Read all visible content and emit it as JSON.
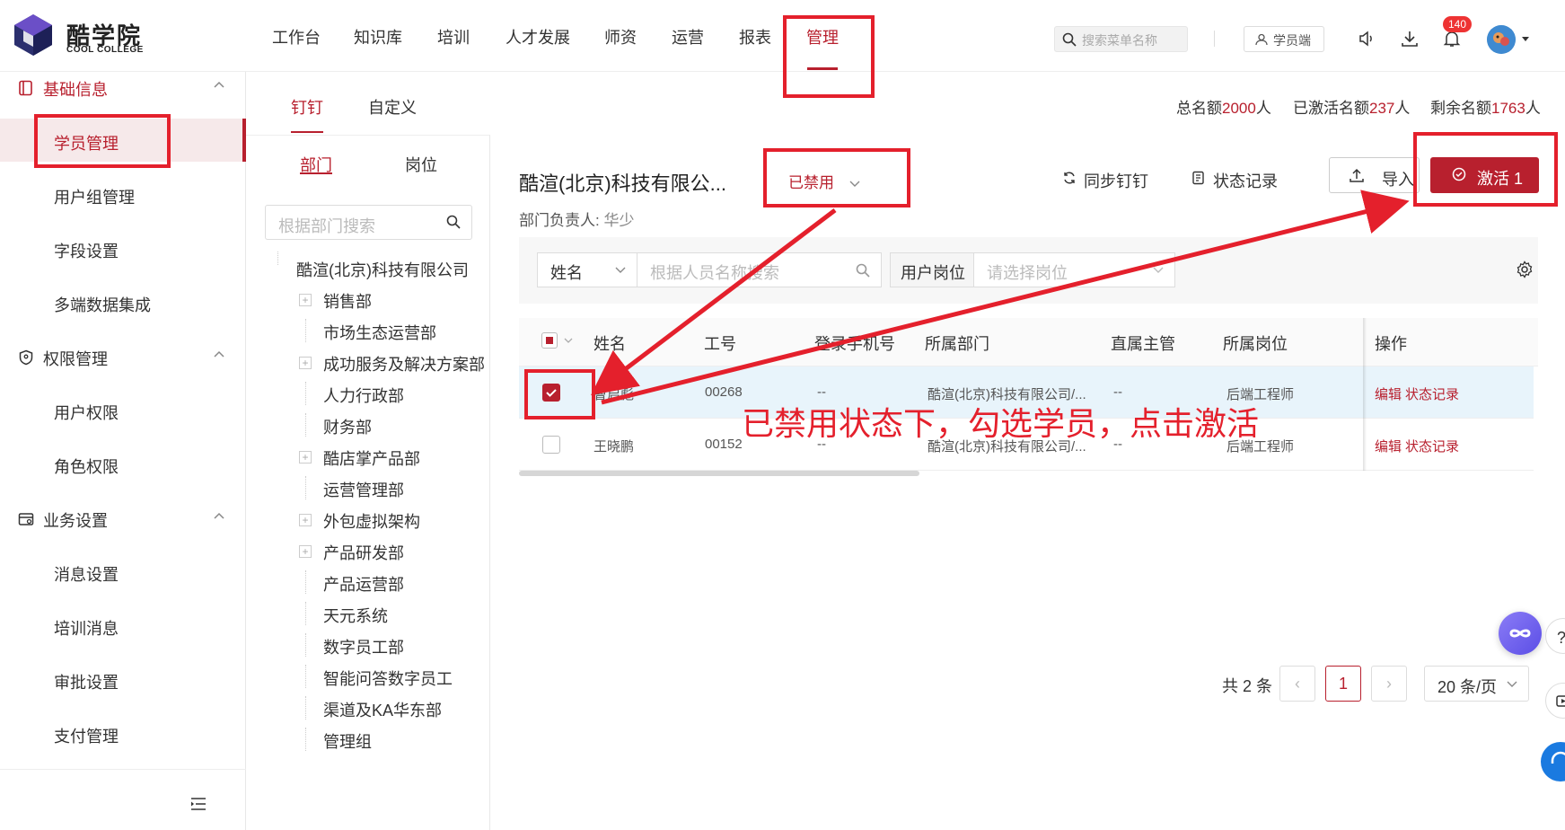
{
  "brand": {
    "name_cn": "酷学院",
    "name_en": "COOL COLLEGE"
  },
  "topnav": {
    "items": [
      "工作台",
      "知识库",
      "培训",
      "人才发展",
      "师资",
      "运营",
      "报表",
      "管理"
    ],
    "active": "管理",
    "search_placeholder": "搜索菜单名称",
    "student_portal": "学员端",
    "notification_count": "140"
  },
  "sidebar": {
    "groups": [
      {
        "label": "基础信息",
        "icon": "book-icon",
        "items": [
          "学员管理",
          "用户组管理",
          "字段设置",
          "多端数据集成"
        ]
      },
      {
        "label": "权限管理",
        "icon": "shield-icon",
        "items": [
          "用户权限",
          "角色权限"
        ]
      },
      {
        "label": "业务设置",
        "icon": "settings-card-icon",
        "items": [
          "消息设置",
          "培训消息",
          "审批设置",
          "支付管理"
        ]
      }
    ],
    "active_item": "学员管理"
  },
  "source_tabs": {
    "items": [
      "钉钉",
      "自定义"
    ],
    "active": "钉钉"
  },
  "quota": {
    "total_label": "总名额",
    "total": "2000",
    "total_unit": "人",
    "activated_label": "已激活名额",
    "activated": "237",
    "activated_unit": "人",
    "remaining_label": "剩余名额",
    "remaining": "1763",
    "remaining_unit": "人"
  },
  "dept_panel": {
    "tabs": [
      "部门",
      "岗位"
    ],
    "active": "部门",
    "search_placeholder": "根据部门搜索",
    "root": "酷渲(北京)科技有限公司",
    "departments": [
      {
        "name": "销售部",
        "expandable": true
      },
      {
        "name": "市场生态运营部",
        "expandable": false
      },
      {
        "name": "成功服务及解决方案部",
        "expandable": true
      },
      {
        "name": "人力行政部",
        "expandable": false
      },
      {
        "name": "财务部",
        "expandable": false
      },
      {
        "name": "酷店掌产品部",
        "expandable": true
      },
      {
        "name": "运营管理部",
        "expandable": false
      },
      {
        "name": "外包虚拟架构",
        "expandable": true
      },
      {
        "name": "产品研发部",
        "expandable": true
      },
      {
        "name": "产品运营部",
        "expandable": false
      },
      {
        "name": "天元系统",
        "expandable": false
      },
      {
        "name": "数字员工部",
        "expandable": false
      },
      {
        "name": "智能问答数字员工",
        "expandable": false
      },
      {
        "name": "渠道及KA华东部",
        "expandable": false
      },
      {
        "name": "管理组",
        "expandable": false
      }
    ]
  },
  "main": {
    "company_title": "酷渲(北京)科技有限公...",
    "status_filter": "已禁用",
    "sync_label": "同步钉钉",
    "status_log_label": "状态记录",
    "import_label": "导入",
    "activate_label": "激活 1",
    "dept_lead_label": "部门负责人:",
    "dept_lead_name": "华少",
    "filter": {
      "field_select": "姓名",
      "name_placeholder": "根据人员名称搜索",
      "position_label": "用户岗位",
      "position_placeholder": "请选择岗位"
    },
    "table": {
      "columns": [
        "姓名",
        "工号",
        "登录手机号",
        "所属部门",
        "直属主管",
        "所属岗位",
        "操作"
      ],
      "rows": [
        {
          "checked": true,
          "name": "曹启彪",
          "id": "00268",
          "phone": "--",
          "dept": "酷渲(北京)科技有限公司/...",
          "manager": "--",
          "position": "后端工程师",
          "edit": "编辑",
          "log": "状态记录"
        },
        {
          "checked": false,
          "name": "王晓鹏",
          "id": "00152",
          "phone": "--",
          "dept": "酷渲(北京)科技有限公司/...",
          "manager": "--",
          "position": "后端工程师",
          "edit": "编辑",
          "log": "状态记录"
        }
      ]
    },
    "pagination": {
      "total": "共 2 条",
      "current": "1",
      "page_size": "20 条/页"
    }
  },
  "annotation": {
    "text": "已禁用状态下，勾选学员，点击激活",
    "color": "#e4202c"
  },
  "colors": {
    "brand": "#b8202e",
    "annotation": "#e4202c",
    "row_highlight": "#e8f4fb"
  }
}
